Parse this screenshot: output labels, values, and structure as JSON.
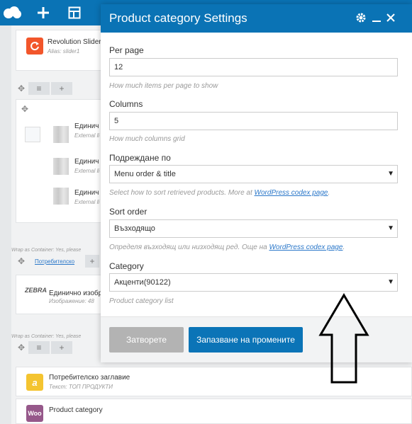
{
  "toolbar": {
    "icons": [
      "logo-icon",
      "add-icon",
      "templates-icon"
    ]
  },
  "background": {
    "revolution": {
      "title": "Revolution Slider",
      "alias": "Alias: slider1"
    },
    "inner_items": [
      {
        "title": "Единич",
        "sub": "External li"
      },
      {
        "title": "Единич",
        "sub": "External li"
      },
      {
        "title": "Единич",
        "sub": "External li"
      }
    ],
    "wrap_label_1": "Wrap as Container: Yes, please",
    "custom_tab": "Потребителско",
    "zebra": {
      "logo_text": "ZEBRA",
      "title": "Единично изобр",
      "sub": "Изображение: 48"
    },
    "wrap_label_2": "Wrap as Container: Yes, please",
    "custom_heading": {
      "title": "Потребителско заглавие",
      "sub": "Текст: ТОП ПРОДУКТИ"
    },
    "woo": {
      "icon_text": "Woo",
      "title": "Product category"
    }
  },
  "modal": {
    "title": "Product category Settings",
    "per_page": {
      "label": "Per page",
      "value": "12",
      "help": "How much items per page to show"
    },
    "columns": {
      "label": "Columns",
      "value": "5",
      "help": "How much columns grid"
    },
    "order_by": {
      "label": "Подреждане по",
      "value": "Menu order & title",
      "help_prefix": "Select how to sort retrieved products. More at ",
      "help_link": "WordPress codex page",
      "help_suffix": "."
    },
    "sort_order": {
      "label": "Sort order",
      "value": "Възходящо",
      "help_prefix": "Определя възходящ или низходящ ред. Още на ",
      "help_link": "WordPress codex page",
      "help_suffix": "."
    },
    "category": {
      "label": "Category",
      "value": "Акценти(90122)",
      "help": "Product category list"
    },
    "close_label": "Затворете",
    "save_label": "Запазване на промените"
  },
  "colors": {
    "brand_blue": "#0a73b5",
    "close_gray": "#b3b3b3",
    "revolution_orange": "#f2562b",
    "heading_yellow": "#f4c430",
    "woo_purple": "#96588a"
  }
}
